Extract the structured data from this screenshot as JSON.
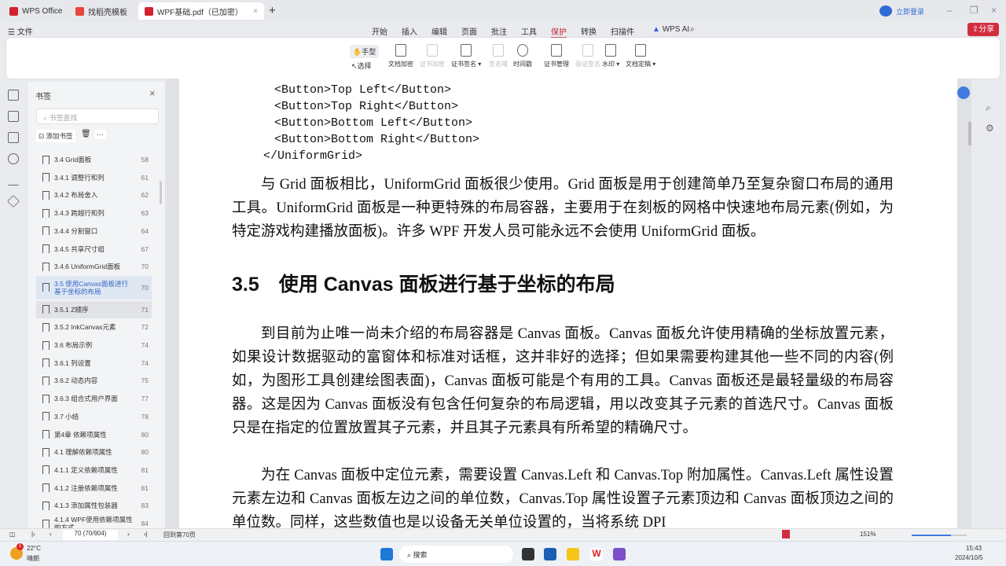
{
  "tabs": [
    {
      "label": "WPS Office"
    },
    {
      "label": "找稻壳模板"
    },
    {
      "label": "WPF基础.pdf（已加密）"
    }
  ],
  "title_bar": {
    "login": "立即登录",
    "share": "分享"
  },
  "menubar": {
    "file": "文件",
    "items": [
      "开始",
      "插入",
      "编辑",
      "页面",
      "批注",
      "工具",
      "保护",
      "转换",
      "扫描件"
    ],
    "active": "保护",
    "ai": "WPS AI"
  },
  "ribbon": {
    "hand": "手型",
    "select": "选择",
    "items": [
      {
        "label": "文档加密",
        "enabled": true
      },
      {
        "label": "证书加密",
        "enabled": false
      },
      {
        "label": "证书签名 ▾",
        "enabled": true
      },
      {
        "label": "签名域",
        "enabled": false
      },
      {
        "label": "时间戳",
        "enabled": true
      },
      {
        "label": "证书管理",
        "enabled": true
      },
      {
        "label": "验证签名",
        "enabled": false
      },
      {
        "label": "水印 ▾",
        "enabled": true
      },
      {
        "label": "文档定稿 ▾",
        "enabled": true
      }
    ]
  },
  "bookmarks": {
    "title": "书签",
    "search_placeholder": "书签查找",
    "add": "添加书签",
    "more": "···",
    "items": [
      {
        "label": "3.4 Grid面板",
        "page": "58"
      },
      {
        "label": "3.4.1 调整行和列",
        "page": "61"
      },
      {
        "label": "3.4.2 布局舍入",
        "page": "62"
      },
      {
        "label": "3.4.3 跨越行和列",
        "page": "63"
      },
      {
        "label": "3.4.4 分割窗口",
        "page": "64"
      },
      {
        "label": "3.4.5 共享尺寸组",
        "page": "67"
      },
      {
        "label": "3.4.6 UniformGrid面板",
        "page": "70"
      },
      {
        "label": "3.5 使用Canvas面板进行基于坐标的布局",
        "page": "70"
      },
      {
        "label": "3.5.1 Z顺序",
        "page": "71"
      },
      {
        "label": "3.5.2 InkCanvas元素",
        "page": "72"
      },
      {
        "label": "3.6 布局示例",
        "page": "74"
      },
      {
        "label": "3.6.1 列设置",
        "page": "74"
      },
      {
        "label": "3.6.2 动态内容",
        "page": "75"
      },
      {
        "label": "3.6.3 组合式用户界面",
        "page": "77"
      },
      {
        "label": "3.7 小结",
        "page": "78"
      },
      {
        "label": "第4章 依赖项属性",
        "page": "80"
      },
      {
        "label": "4.1 理解依赖项属性",
        "page": "80"
      },
      {
        "label": "4.1.1 定义依赖项属性",
        "page": "81"
      },
      {
        "label": "4.1.2 注册依赖项属性",
        "page": "81"
      },
      {
        "label": "4.1.3 添加属性包装器",
        "page": "83"
      },
      {
        "label": "4.1.4 WPF使用依赖项属性的方式",
        "page": "84"
      }
    ]
  },
  "document": {
    "code": [
      "<Button>Top Left</Button>",
      "<Button>Top Right</Button>",
      "<Button>Bottom Left</Button>",
      "<Button>Bottom Right</Button>",
      "</UniformGrid>"
    ],
    "p1": "与 Grid 面板相比，UniformGrid 面板很少使用。Grid 面板是用于创建简单乃至复杂窗口布局的通用工具。UniformGrid 面板是一种更特殊的布局容器，主要用于在刻板的网格中快速地布局元素(例如，为特定游戏构建播放面板)。许多 WPF 开发人员可能永远不会使用 UniformGrid 面板。",
    "heading": "3.5　使用 Canvas 面板进行基于坐标的布局",
    "p2": "到目前为止唯一尚未介绍的布局容器是 Canvas 面板。Canvas 面板允许使用精确的坐标放置元素，如果设计数据驱动的富窗体和标准对话框，这并非好的选择；但如果需要构建其他一些不同的内容(例如，为图形工具创建绘图表面)，Canvas 面板可能是个有用的工具。Canvas 面板还是最轻量级的布局容器。这是因为 Canvas 面板没有包含任何复杂的布局逻辑，用以改变其子元素的首选尺寸。Canvas 面板只是在指定的位置放置其子元素，并且其子元素具有所希望的精确尺寸。",
    "p3": "为在 Canvas 面板中定位元素，需要设置 Canvas.Left 和 Canvas.Top 附加属性。Canvas.Left 属性设置元素左边和 Canvas 面板左边之间的单位数，Canvas.Top 属性设置子元素顶边和 Canvas 面板顶边之间的单位数。同样，这些数值也是以设备无关单位设置的，当将系统 DPI"
  },
  "status": {
    "page_input": "70 (70/904)",
    "back": "回到第70页",
    "zoom": "151%"
  },
  "taskbar": {
    "temp": "22°C",
    "weather": "晴朗",
    "badge": "1",
    "search": "搜索",
    "time": "15:43",
    "date": "2024/10/5"
  }
}
